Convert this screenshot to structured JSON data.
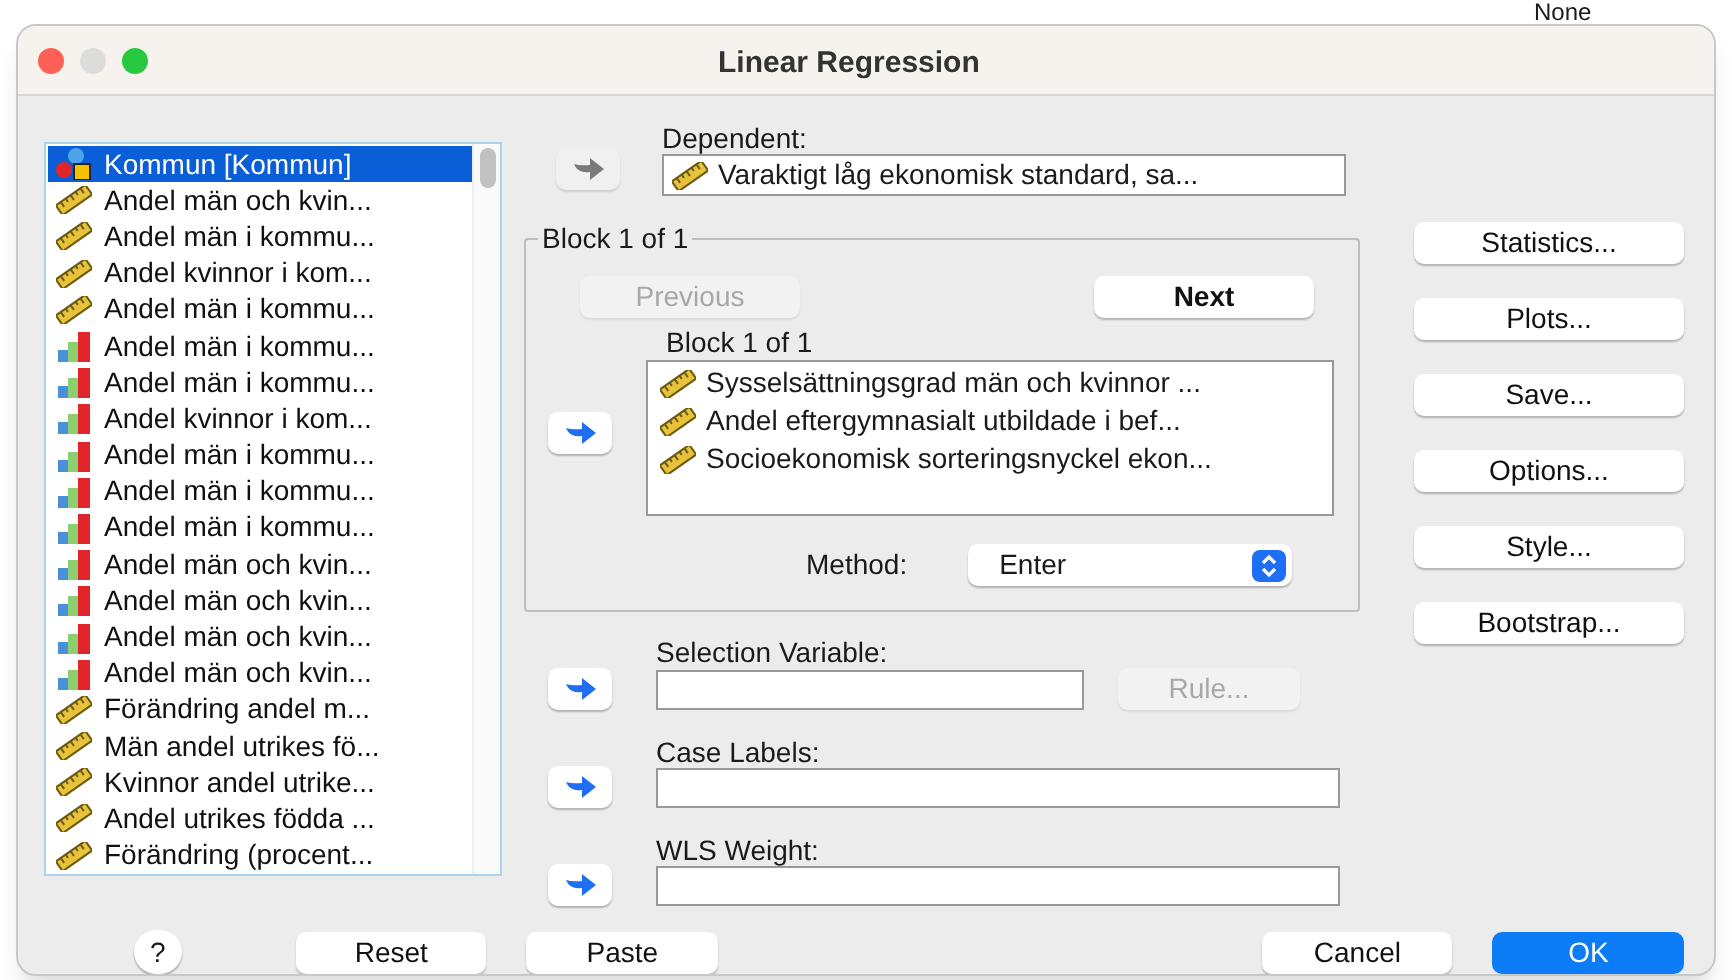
{
  "background": {
    "cell_text": "None"
  },
  "window": {
    "title": "Linear Regression"
  },
  "variables": [
    {
      "label": "Kommun [Kommun]",
      "kind": "nominal",
      "selected": true
    },
    {
      "label": "Andel män och kvin...",
      "kind": "scale",
      "selected": false
    },
    {
      "label": "Andel män i kommu...",
      "kind": "scale",
      "selected": false
    },
    {
      "label": "Andel kvinnor i kom...",
      "kind": "scale",
      "selected": false
    },
    {
      "label": "Andel män i kommu...",
      "kind": "scale",
      "selected": false
    },
    {
      "label": "Andel män i kommu...",
      "kind": "ordinal",
      "selected": false
    },
    {
      "label": "Andel män i kommu...",
      "kind": "ordinal",
      "selected": false
    },
    {
      "label": "Andel kvinnor i kom...",
      "kind": "ordinal",
      "selected": false
    },
    {
      "label": "Andel män i kommu...",
      "kind": "ordinal",
      "selected": false
    },
    {
      "label": "Andel män i kommu...",
      "kind": "ordinal",
      "selected": false
    },
    {
      "label": "Andel män i kommu...",
      "kind": "ordinal",
      "selected": false
    },
    {
      "label": "Andel män och kvin...",
      "kind": "ordinal",
      "selected": false
    },
    {
      "label": "Andel män och kvin...",
      "kind": "ordinal",
      "selected": false
    },
    {
      "label": "Andel män och kvin...",
      "kind": "ordinal",
      "selected": false
    },
    {
      "label": "Andel män och kvin...",
      "kind": "ordinal",
      "selected": false
    },
    {
      "label": "Förändring andel m...",
      "kind": "scale",
      "selected": false
    },
    {
      "label": "Män andel utrikes fö...",
      "kind": "scale",
      "selected": false
    },
    {
      "label": "Kvinnor andel utrike...",
      "kind": "scale",
      "selected": false
    },
    {
      "label": "Andel utrikes födda ...",
      "kind": "scale",
      "selected": false
    },
    {
      "label": "Förändring (procent...",
      "kind": "scale",
      "selected": false
    }
  ],
  "dependent": {
    "label": "Dependent:",
    "arrow_enabled": false,
    "value": {
      "label": "Varaktigt låg ekonomisk standard, sa...",
      "kind": "scale"
    }
  },
  "block": {
    "title": "Block 1 of 1",
    "previous": {
      "label": "Previous",
      "disabled": true
    },
    "next": {
      "label": "Next",
      "disabled": false
    },
    "list_label": "Block 1 of 1",
    "arrow_enabled": true,
    "independents": [
      {
        "label": "Sysselsättningsgrad män och kvinnor ...",
        "kind": "scale"
      },
      {
        "label": "Andel eftergymnasialt utbildade i bef...",
        "kind": "scale"
      },
      {
        "label": "Socioekonomisk sorteringsnyckel ekon...",
        "kind": "scale"
      }
    ],
    "method_label": "Method:",
    "method": "Enter"
  },
  "selection_variable": {
    "label": "Selection Variable:",
    "arrow_enabled": true,
    "rule": {
      "label": "Rule...",
      "disabled": true
    }
  },
  "case_labels": {
    "label": "Case Labels:",
    "arrow_enabled": true
  },
  "wls_weight": {
    "label": "WLS Weight:",
    "arrow_enabled": true
  },
  "side_buttons": [
    "Statistics...",
    "Plots...",
    "Save...",
    "Options...",
    "Style...",
    "Bootstrap..."
  ],
  "footer": {
    "help": "?",
    "buttons": [
      {
        "label": "Reset",
        "kind": "normal"
      },
      {
        "label": "Paste",
        "kind": "normal"
      },
      {
        "label": "Cancel",
        "kind": "normal"
      },
      {
        "label": "OK",
        "kind": "default"
      }
    ]
  }
}
